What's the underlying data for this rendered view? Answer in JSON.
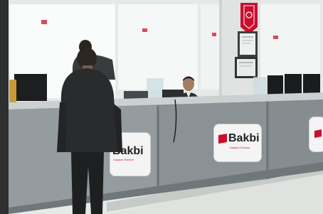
{
  "brand": {
    "name": "Bakbi",
    "tagline": "Caspian Service",
    "color_red": "#c8102e"
  },
  "signs": {
    "left": {
      "name": "Bakbi",
      "tagline": "Caspian Service"
    },
    "center": {
      "name": "Bakbi",
      "tagline": "Caspian Service"
    }
  },
  "colors": {
    "wall": "#e9eceb",
    "window_glow": "#ffffff",
    "counter_front": "#8f9698",
    "counter_top": "#c9cdcd",
    "floor": "#dfe2df",
    "suit": "#2a2b2d"
  }
}
